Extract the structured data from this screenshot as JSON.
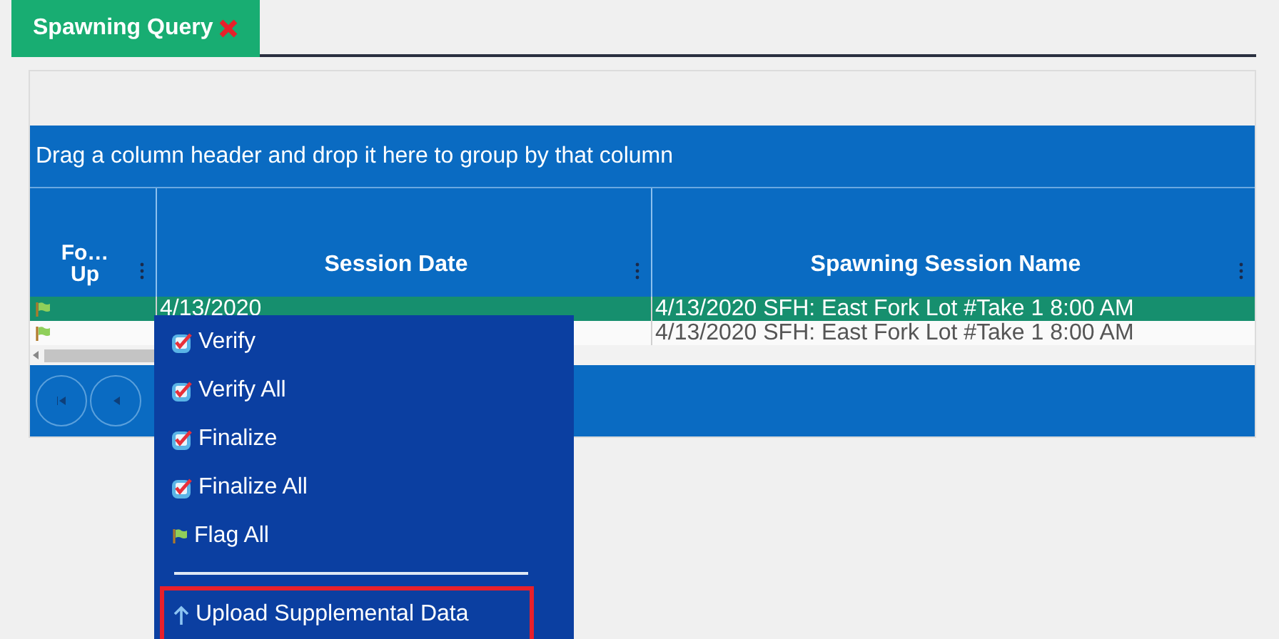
{
  "tabs": [
    {
      "label": "Spawning Query",
      "selected": true,
      "closable": true
    }
  ],
  "group_panel": {
    "text": "Drag a column header and drop it here to group by that column"
  },
  "table": {
    "columns": [
      "Fo… Up",
      "Session Date",
      "Spawning Session Name"
    ],
    "rows": [
      {
        "selected": true,
        "flagged": true,
        "session_date": "4/13/2020",
        "session_name": "4/13/2020 SFH: East Fork Lot #Take 1 8:00 AM"
      },
      {
        "selected": false,
        "flagged": true,
        "session_name": "4/13/2020 SFH: East Fork Lot #Take 1 8:00 AM"
      }
    ]
  },
  "context_menu": {
    "items": [
      {
        "kind": "check",
        "label": "Verify",
        "selected": false
      },
      {
        "kind": "check",
        "label": "Verify All",
        "selected": false
      },
      {
        "kind": "check",
        "label": "Finalize",
        "selected": false
      },
      {
        "kind": "check",
        "label": "Finalize All",
        "selected": false
      },
      {
        "kind": "flag",
        "label": "Flag All",
        "selected": false
      },
      {
        "kind": "separator"
      },
      {
        "kind": "upload",
        "label": "Upload Supplemental Data",
        "selected": true
      }
    ]
  }
}
